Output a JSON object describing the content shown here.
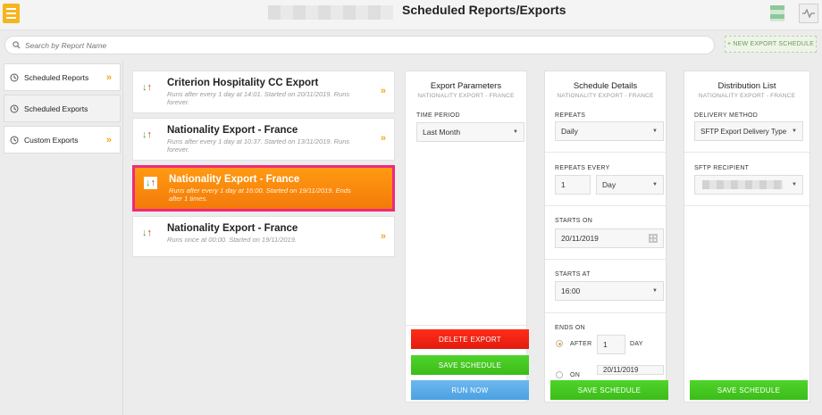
{
  "header": {
    "title": "Scheduled Reports/Exports"
  },
  "search": {
    "placeholder": "Search by Report Name"
  },
  "new_schedule_label": "+ NEW EXPORT SCHEDULE",
  "sidebar": {
    "items": [
      {
        "label": "Scheduled Reports",
        "icon": "clock-icon"
      },
      {
        "label": "Scheduled Exports",
        "icon": "clock-icon"
      },
      {
        "label": "Custom Exports",
        "icon": "clock-icon"
      }
    ],
    "active_index": 1
  },
  "exports": [
    {
      "name": "Criterion Hospitality CC Export",
      "desc": "Runs after every 1 day at 14:01. Started on 20/11/2019. Runs forever."
    },
    {
      "name": "Nationality Export - France",
      "desc": "Runs after every 1 day at 10:37. Started on 13/11/2019. Runs forever."
    },
    {
      "name": "Nationality Export - France",
      "desc": "Runs after every 1 day at 16:00. Started on 19/11/2019. Ends after 1 times."
    },
    {
      "name": "Nationality Export - France",
      "desc": "Runs once at 00:00. Started on 19/11/2019."
    }
  ],
  "selected_index": 2,
  "export_params": {
    "title": "Export Parameters",
    "subtitle": "NATIONALITY EXPORT - FRANCE",
    "time_period_label": "TIME PERIOD",
    "time_period_value": "Last Month",
    "delete_label": "DELETE EXPORT",
    "save_label": "SAVE SCHEDULE",
    "run_label": "RUN NOW"
  },
  "schedule": {
    "title": "Schedule Details",
    "subtitle": "NATIONALITY EXPORT - FRANCE",
    "repeats_label": "REPEATS",
    "repeats_value": "Daily",
    "repeats_every_label": "REPEATS EVERY",
    "repeats_every_num": "1",
    "repeats_every_unit": "Day",
    "starts_on_label": "STARTS ON",
    "starts_on_value": "20/11/2019",
    "starts_at_label": "STARTS AT",
    "starts_at_value": "16:00",
    "ends_on_label": "ENDS ON",
    "after_label": "AFTER",
    "after_value": "1",
    "day_label": "DAY",
    "on_label": "ON",
    "on_value": "20/11/2019",
    "save_label": "SAVE SCHEDULE"
  },
  "distribution": {
    "title": "Distribution List",
    "subtitle": "NATIONALITY EXPORT - FRANCE",
    "method_label": "DELIVERY METHOD",
    "method_value": "SFTP Export Delivery Type",
    "recipient_label": "SFTP RECIPIENT",
    "save_label": "SAVE SCHEDULE"
  },
  "colors": {
    "accent": "#f5a623",
    "selected_border": "#ee2a7b",
    "delete": "#ff2d1a",
    "save": "#4fd42a",
    "run": "#6fb8ee"
  }
}
